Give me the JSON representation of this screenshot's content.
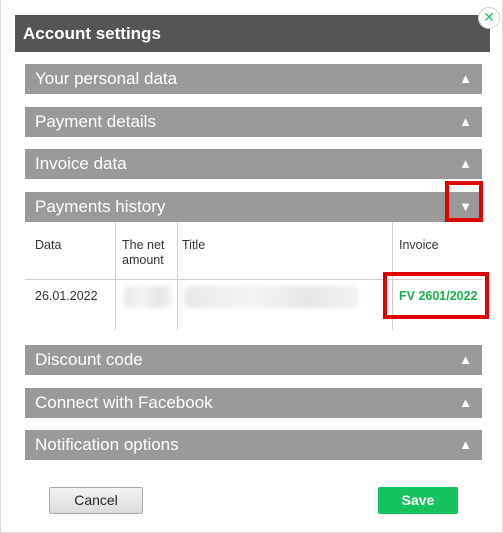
{
  "dialog": {
    "title": "Account settings",
    "close_icon": "close-icon",
    "close_glyph": "✕"
  },
  "sections": [
    {
      "label": "Your personal data",
      "expanded": false
    },
    {
      "label": "Payment details",
      "expanded": false
    },
    {
      "label": "Invoice data",
      "expanded": false
    },
    {
      "label": "Payments history",
      "expanded": true
    },
    {
      "label": "Discount code",
      "expanded": false
    },
    {
      "label": "Connect with Facebook",
      "expanded": false
    },
    {
      "label": "Notification options",
      "expanded": false
    }
  ],
  "arrows": {
    "collapsed": "▲",
    "expanded": "▼"
  },
  "payments_table": {
    "headers": [
      "Data",
      "The net amount",
      "Title",
      "Invoice"
    ],
    "rows": [
      {
        "date": "26.01.2022",
        "net_amount": "",
        "title": "",
        "invoice": "FV 2601/2022"
      }
    ]
  },
  "footer": {
    "cancel_label": "Cancel",
    "save_label": "Save"
  },
  "colors": {
    "titlebar": "#555555",
    "section": "#9a9a9a",
    "accent_green": "#16c25d",
    "invoice_link": "#12b34a",
    "highlight": "#e10000"
  }
}
